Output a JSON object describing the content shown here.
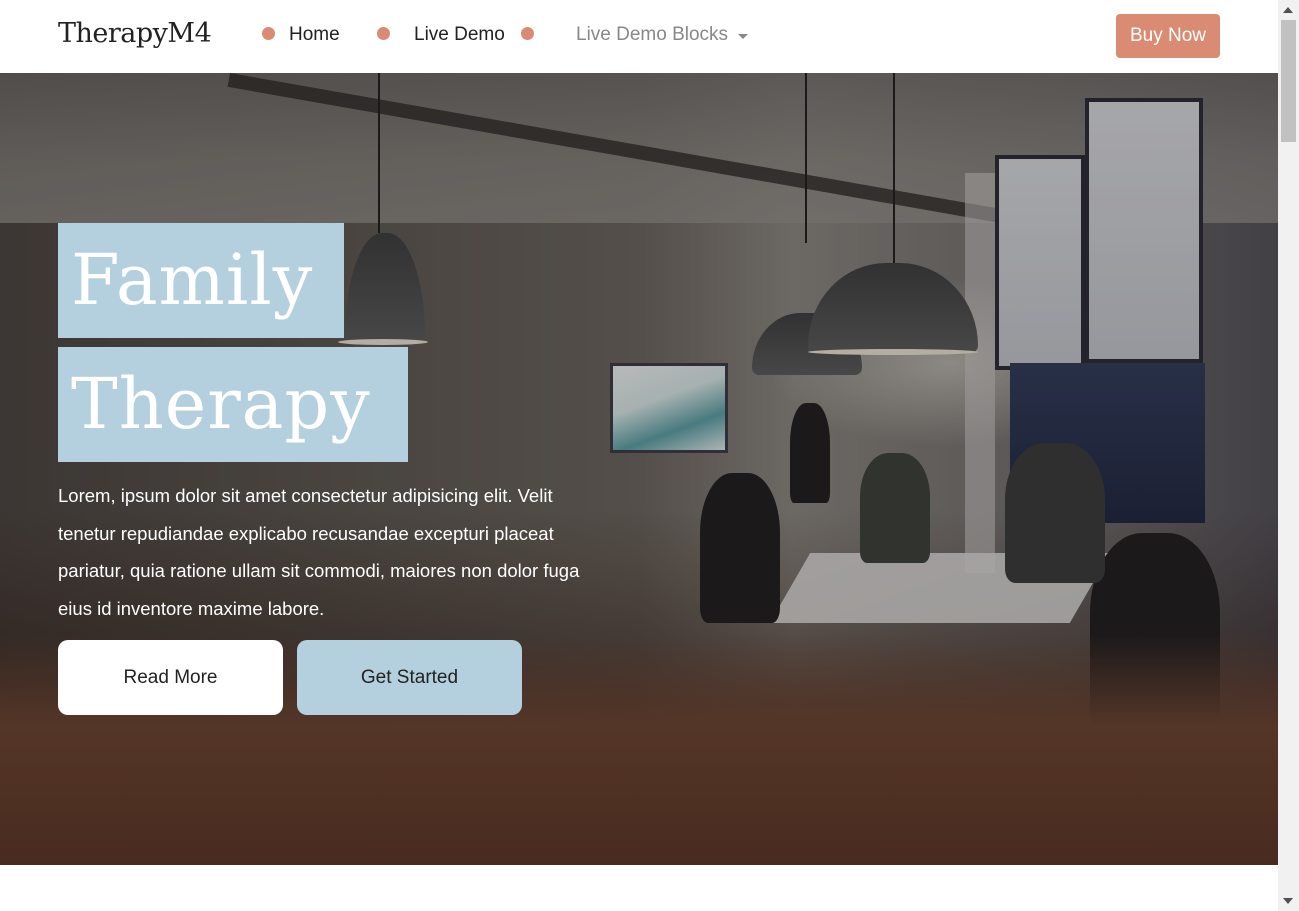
{
  "navbar": {
    "brand": "TherapyM4",
    "items": [
      {
        "label": "Home"
      },
      {
        "label": "Live Demo"
      },
      {
        "label": "Live Demo Blocks"
      }
    ],
    "buy_label": "Buy Now"
  },
  "hero": {
    "title_line1": "Family",
    "title_line2": "Therapy",
    "text": "Lorem, ipsum dolor sit amet consectetur adipisicing elit. Velit tenetur repudiandae explicabo recusandae excepturi placeat pariatur, quia ratione ullam sit commodi, maiores non dolor fuga eius id inventore maxime labore.",
    "read_more_label": "Read More",
    "get_started_label": "Get Started"
  },
  "colors": {
    "accent": "#d98b73",
    "highlight": "#b4d0de",
    "text_dark": "#222222"
  }
}
